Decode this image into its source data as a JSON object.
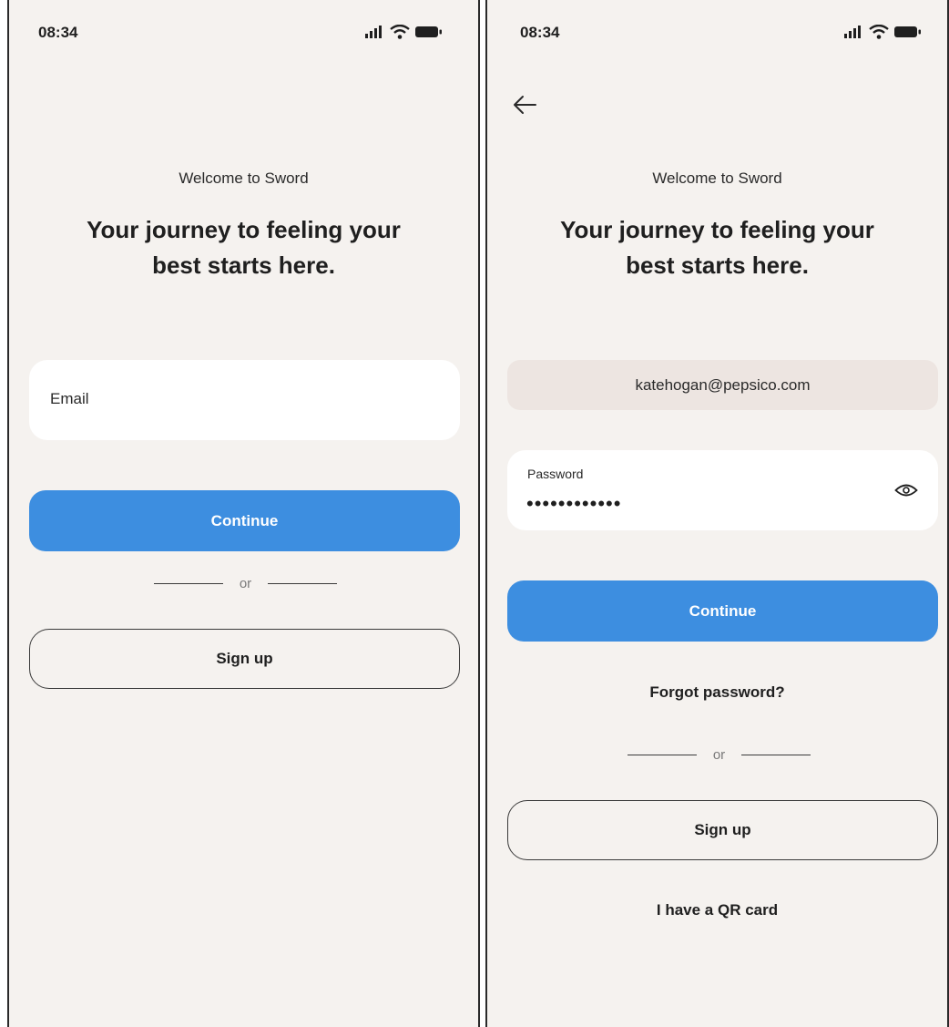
{
  "left_screen": {
    "status_bar": {
      "time": "08:34",
      "icons": [
        "signal-icon",
        "wifi-icon",
        "battery-icon"
      ]
    },
    "welcome_text": "Welcome to Sword",
    "headline_line1": "Your journey to feeling your",
    "headline_line2": "best starts here.",
    "email_placeholder": "Email",
    "continue_label": "Continue",
    "or_label": "or",
    "signup_label": "Sign up"
  },
  "right_screen": {
    "status_bar": {
      "time": "08:34",
      "icons": [
        "signal-icon",
        "wifi-icon",
        "battery-icon"
      ]
    },
    "back_icon": "arrow-left-icon",
    "welcome_text": "Welcome to Sword",
    "headline_line1": "Your journey to feeling your",
    "headline_line2": "best starts here.",
    "email_value": "katehogan@pepsico.com",
    "password_label": "Password",
    "password_value": "••••••••••••",
    "password_toggle_icon": "eye-icon",
    "continue_label": "Continue",
    "forgot_password_label": "Forgot password?",
    "or_label": "or",
    "signup_label": "Sign up",
    "qr_card_label": "I have a QR card"
  },
  "colors": {
    "background": "#f5f2ef",
    "primary_button": "#3d8ee0",
    "prefilled_field": "#ede5e1",
    "input_background": "#ffffff",
    "text": "#1f1f1f"
  }
}
